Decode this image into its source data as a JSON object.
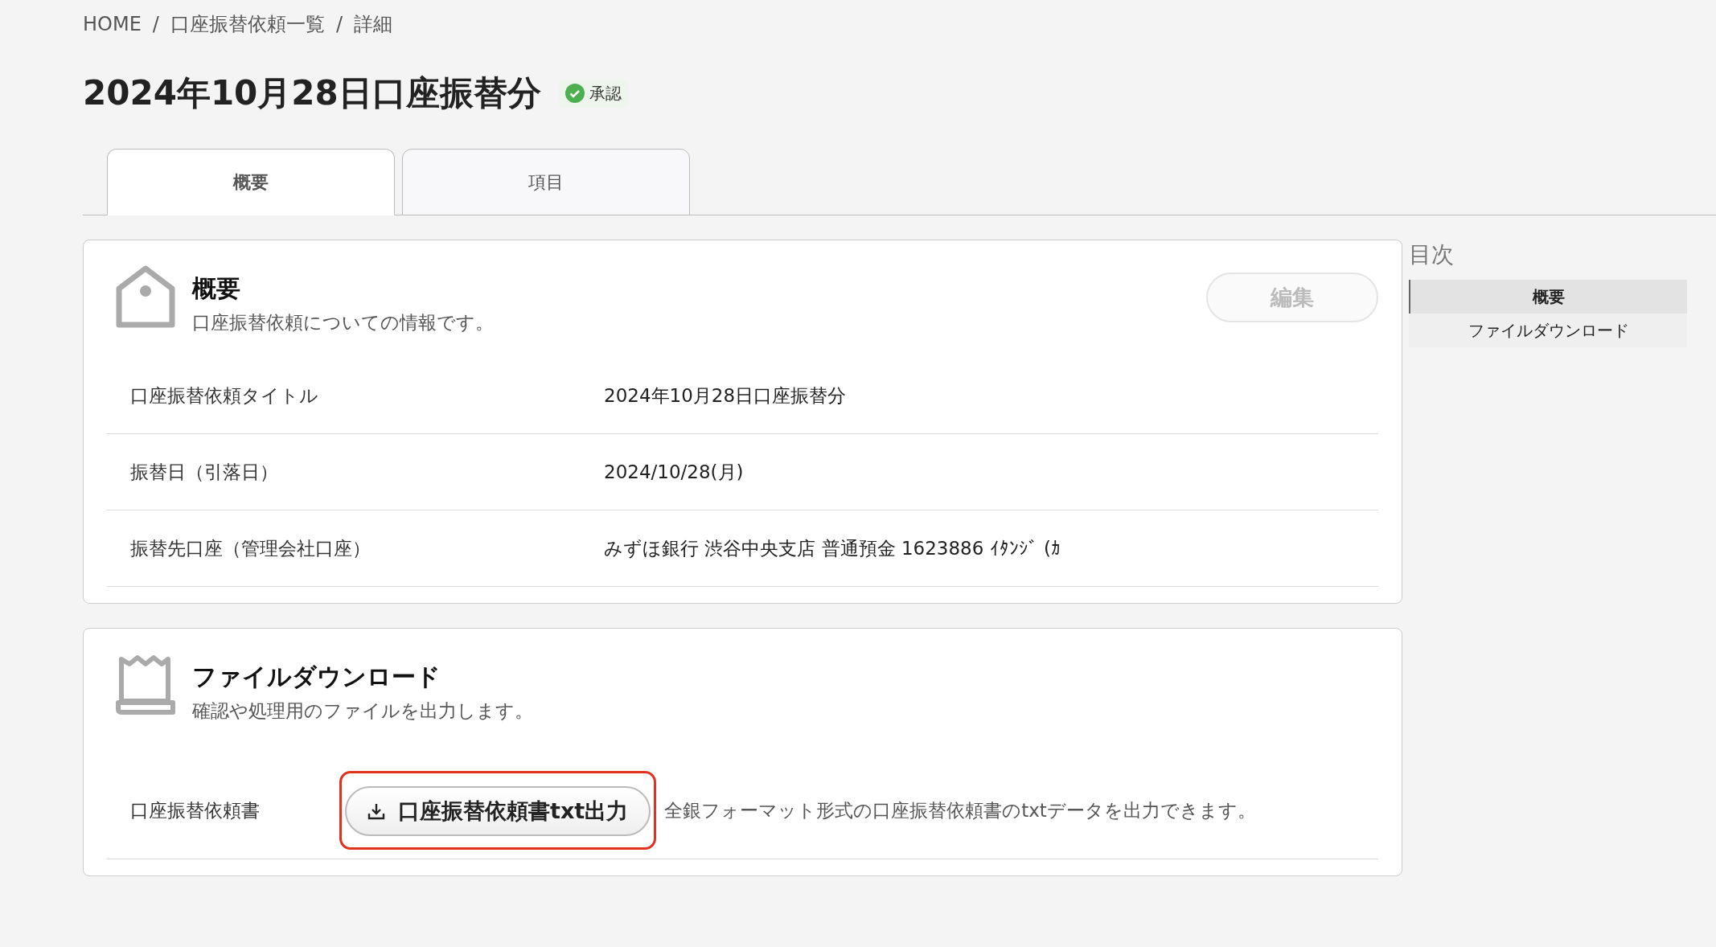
{
  "breadcrumb": [
    {
      "label": "HOME"
    },
    {
      "label": "口座振替依頼一覧"
    },
    {
      "label": "詳細"
    }
  ],
  "breadcrumb_separator": "/",
  "page_title": "2024年10月28日口座振替分",
  "status_badge": {
    "label": "承認",
    "kind": "approved"
  },
  "tabs": [
    {
      "label": "概要",
      "selected": true
    },
    {
      "label": "項目",
      "selected": false
    }
  ],
  "overview_card": {
    "title": "概要",
    "subtitle": "口座振替依頼についての情報です。",
    "edit_button": {
      "label": "編集",
      "disabled": true
    },
    "rows": [
      {
        "label": "口座振替依頼タイトル",
        "value": "2024年10月28日口座振替分"
      },
      {
        "label": "振替日（引落日）",
        "value": "2024/10/28(月)"
      },
      {
        "label": "振替先口座（管理会社口座）",
        "value": "みずほ銀行 渋谷中央支店 普通預金 1623886 ｲﾀﾝｼﾞ (ｶ"
      }
    ]
  },
  "download_card": {
    "title": "ファイルダウンロード",
    "subtitle": "確認や処理用のファイルを出力します。",
    "rows": [
      {
        "label": "口座振替依頼書",
        "button": "口座振替依頼書txt出力",
        "highlighted": true,
        "description": "全銀フォーマット形式の口座振替依頼書のtxtデータを出力できます。"
      }
    ]
  },
  "table_of_contents": {
    "title": "目次",
    "items": [
      {
        "label": "概要",
        "selected": true
      },
      {
        "label": "ファイルダウンロード",
        "selected": false
      }
    ]
  }
}
